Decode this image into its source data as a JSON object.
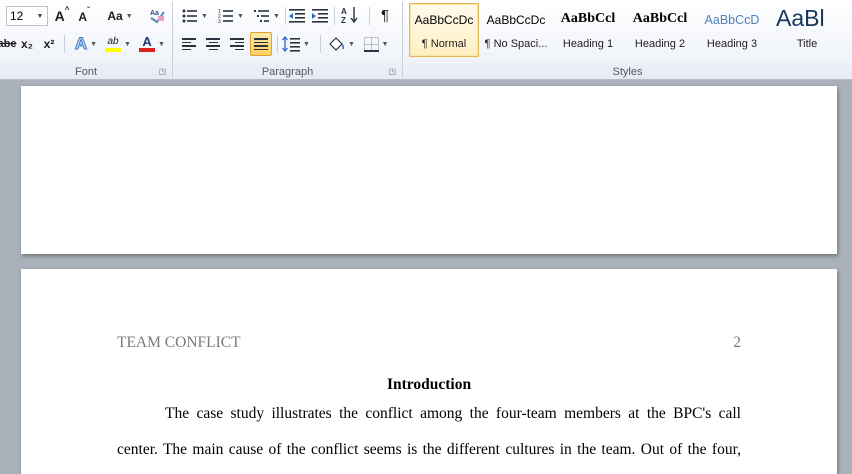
{
  "ribbon": {
    "font_group": {
      "label": "Font",
      "font_size": "12",
      "grow_font": "A",
      "shrink_font": "A",
      "change_case": "Aa",
      "strikethrough": "abe",
      "subscript": "x₂",
      "superscript": "x²",
      "text_effects": "A",
      "highlight": "ab",
      "font_color": "A",
      "colors": {
        "highlight": "#ffff00",
        "font_color": "#e0201b"
      }
    },
    "paragraph_group": {
      "label": "Paragraph",
      "pilcrow": "¶"
    },
    "styles_group": {
      "label": "Styles",
      "styles": [
        {
          "preview": "AaBbCcDc",
          "name": "¶ Normal",
          "active": true
        },
        {
          "preview": "AaBbCcDc",
          "name": "¶ No Spaci..."
        },
        {
          "preview": "AaBbCcl",
          "name": "Heading 1"
        },
        {
          "preview": "AaBbCcl",
          "name": "Heading 2"
        },
        {
          "preview": "AaBbCcD",
          "name": "Heading 3"
        },
        {
          "preview": "AaBl",
          "name": "Title"
        }
      ]
    }
  },
  "document": {
    "running_header": "TEAM CONFLICT",
    "page_number": "2",
    "heading": "Introduction",
    "paragraph_lines": [
      "The case study illustrates the conflict among the four-team members at the BPC's call",
      "center. The main cause of the conflict seems is the different cultures in the team. Out of the four,"
    ]
  }
}
